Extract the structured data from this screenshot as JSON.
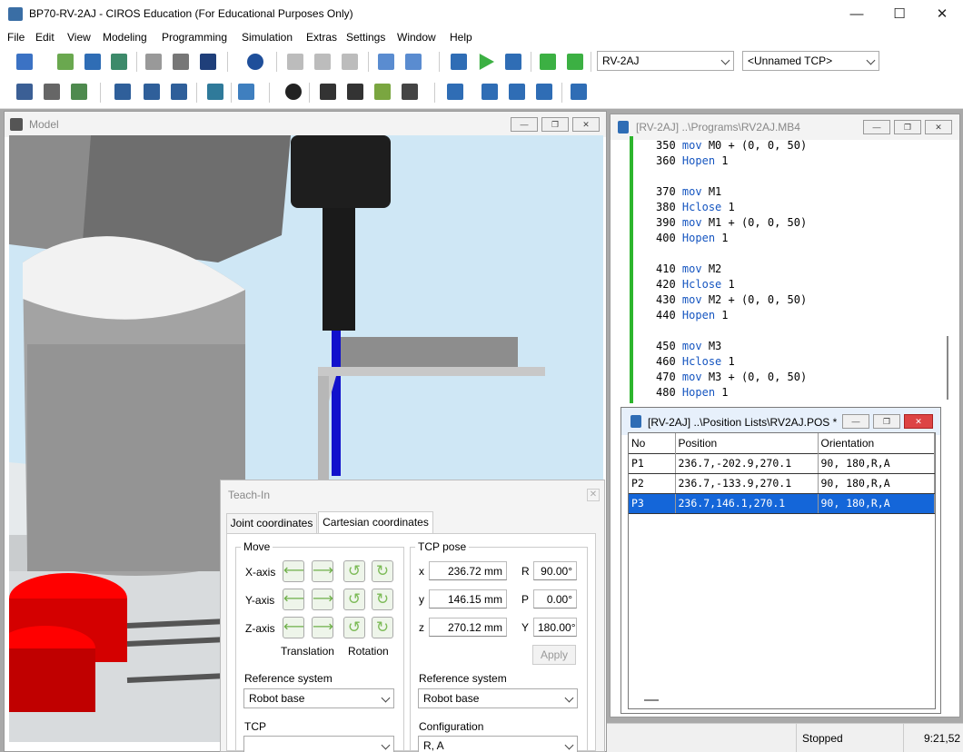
{
  "window": {
    "title": "BP70-RV-2AJ - CIROS Education (For Educational Purposes Only)"
  },
  "menu": [
    "File",
    "Edit",
    "View",
    "Modeling",
    "Programming",
    "Simulation",
    "Extras",
    "Settings",
    "Window",
    "Help"
  ],
  "toolbar": {
    "robot_select": "RV-2AJ",
    "tcp_select": "<Unnamed TCP>"
  },
  "model_window": {
    "title": "Model"
  },
  "program_window": {
    "title": "[RV-2AJ] ..\\Programs\\RV2AJ.MB4",
    "lines": [
      {
        "no": "350",
        "kw": "mov",
        "rest": " M0 + (0, 0, 50)"
      },
      {
        "no": "360",
        "kw": "Hopen",
        "rest": " 1"
      },
      {
        "no": "",
        "kw": "",
        "rest": ""
      },
      {
        "no": "370",
        "kw": "mov",
        "rest": " M1"
      },
      {
        "no": "380",
        "kw": "Hclose",
        "rest": " 1"
      },
      {
        "no": "390",
        "kw": "mov",
        "rest": " M1 + (0, 0, 50)"
      },
      {
        "no": "400",
        "kw": "Hopen",
        "rest": " 1"
      },
      {
        "no": "",
        "kw": "",
        "rest": ""
      },
      {
        "no": "410",
        "kw": "mov",
        "rest": " M2"
      },
      {
        "no": "420",
        "kw": "Hclose",
        "rest": " 1"
      },
      {
        "no": "430",
        "kw": "mov",
        "rest": " M2 + (0, 0, 50)"
      },
      {
        "no": "440",
        "kw": "Hopen",
        "rest": " 1"
      },
      {
        "no": "",
        "kw": "",
        "rest": ""
      },
      {
        "no": "450",
        "kw": "mov",
        "rest": " M3"
      },
      {
        "no": "460",
        "kw": "Hclose",
        "rest": " 1"
      },
      {
        "no": "470",
        "kw": "mov",
        "rest": " M3 + (0, 0, 50)"
      },
      {
        "no": "480",
        "kw": "Hopen",
        "rest": " 1"
      }
    ]
  },
  "position_window": {
    "title": "[RV-2AJ] ..\\Position Lists\\RV2AJ.POS *",
    "columns": [
      "No",
      "Position",
      "Orientation"
    ],
    "rows": [
      {
        "no": "P1",
        "position": "236.7,-202.9,270.1",
        "orientation": " 90, 180,R,A",
        "selected": false
      },
      {
        "no": "P2",
        "position": "236.7,-133.9,270.1",
        "orientation": " 90, 180,R,A",
        "selected": false
      },
      {
        "no": "P3",
        "position": "236.7,146.1,270.1",
        "orientation": " 90, 180,R,A",
        "selected": true
      }
    ]
  },
  "teach_in": {
    "title": "Teach-In",
    "tabs": [
      "Joint coordinates",
      "Cartesian coordinates"
    ],
    "active_tab": "Cartesian coordinates",
    "move": {
      "label": "Move",
      "axes": [
        "X-axis",
        "Y-axis",
        "Z-axis"
      ],
      "translation_label": "Translation",
      "rotation_label": "Rotation"
    },
    "tcp_pose": {
      "label": "TCP pose",
      "x": {
        "label": "x",
        "value": "236.72 mm"
      },
      "y": {
        "label": "y",
        "value": "146.15 mm"
      },
      "z": {
        "label": "z",
        "value": "270.12 mm"
      },
      "R": {
        "label": "R",
        "value": "90.00°"
      },
      "P": {
        "label": "P",
        "value": "0.00°"
      },
      "Y": {
        "label": "Y",
        "value": "180.00°"
      },
      "apply_label": "Apply"
    },
    "left_reference_label": "Reference system",
    "left_reference_value": "Robot base",
    "tcp_label": "TCP",
    "tcp_value": "",
    "right_reference_label": "Reference system",
    "right_reference_value": "Robot base",
    "configuration_label": "Configuration",
    "configuration_value": "R, A"
  },
  "status": {
    "state": "Stopped",
    "time": "9:21,52"
  },
  "colors": {
    "accent": "#1466d9",
    "code_bar": "#2db52d",
    "keyword": "#1555c0",
    "red_part": "#ff0000",
    "tcp_axis": "#1111cc"
  }
}
